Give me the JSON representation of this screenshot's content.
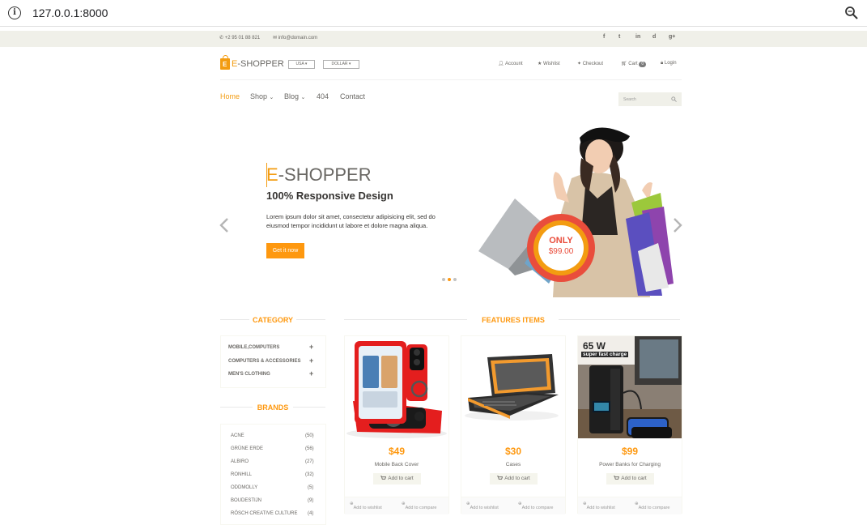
{
  "browser": {
    "url": "127.0.0.1:8000"
  },
  "topbar": {
    "phone": "+2 95 01 88 821",
    "email": "info@domain.com",
    "social": [
      "f",
      "t",
      "in",
      "d",
      "g+"
    ]
  },
  "header": {
    "logo_letter": "E",
    "logo_prefix": "E",
    "logo_rest": "-SHOPPER",
    "country": "USA",
    "currency": "DOLLAR",
    "account": "Account",
    "wishlist": "Wishlist",
    "checkout": "Checkout",
    "cart": "Cart",
    "cart_count": "0",
    "login": "Login"
  },
  "menu": {
    "home": "Home",
    "shop": "Shop",
    "blog": "Blog",
    "notfound": "404",
    "contact": "Contact",
    "search_placeholder": "Search"
  },
  "slider": {
    "title_first": "E",
    "title_rest": "-SHOPPER",
    "subtitle": "100% Responsive Design",
    "description": "Lorem ipsum dolor sit amet, consectetur adipisicing elit, sed do eiusmod tempor incididunt ut labore et dolore magna aliqua.",
    "button": "Get it now",
    "badge_only": "ONLY",
    "badge_price": "$99.00",
    "active_dot": 1
  },
  "sidebar": {
    "category_title": "CATEGORY",
    "categories": [
      "MOBILE,COMPUTERS",
      "COMPUTERS & ACCESSORIES",
      "MEN'S CLOTHING"
    ],
    "brands_title": "BRANDS",
    "brands": [
      {
        "name": "ACNE",
        "count": "(50)"
      },
      {
        "name": "GRÜNE ERDE",
        "count": "(56)"
      },
      {
        "name": "ALBIRO",
        "count": "(27)"
      },
      {
        "name": "RONHILL",
        "count": "(32)"
      },
      {
        "name": "ODDMOLLY",
        "count": "(5)"
      },
      {
        "name": "BOUDESTIJN",
        "count": "(9)"
      },
      {
        "name": "RÖSCH CREATIVE CULTURE",
        "count": "(4)"
      }
    ]
  },
  "features": {
    "title": "FEATURES ITEMS",
    "add_to_cart": "Add to cart",
    "add_to_wishlist": "Add to wishlist",
    "add_to_compare": "Add to compare",
    "products": [
      {
        "price": "$49",
        "name": "Mobile Back Cover"
      },
      {
        "price": "$30",
        "name": "Cases"
      },
      {
        "price": "$99",
        "name": "Power Banks for Charging",
        "image_text": "65 W",
        "image_subtext": "super fast charge"
      }
    ]
  },
  "colors": {
    "accent": "#fe980f",
    "topbar_bg": "#f0f0e9",
    "text": "#696763"
  }
}
